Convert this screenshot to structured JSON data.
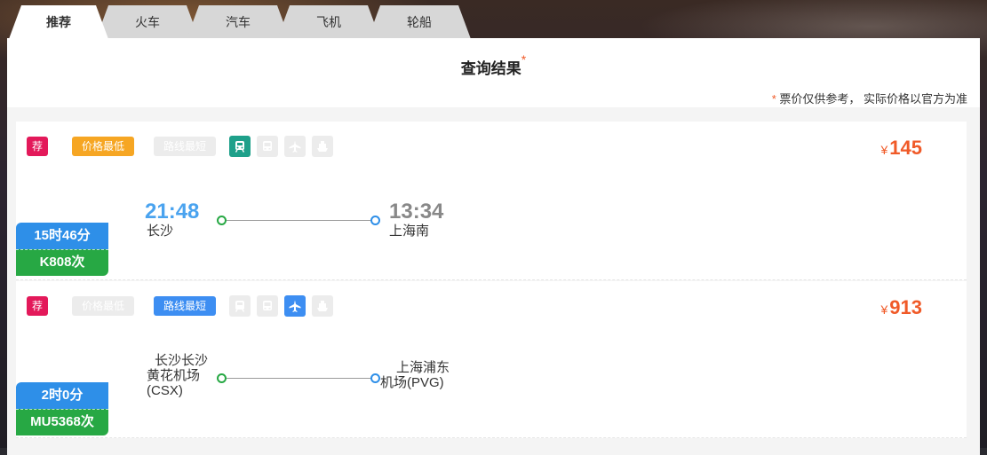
{
  "tabs": [
    {
      "label": "推荐",
      "active": true
    },
    {
      "label": "火车",
      "active": false
    },
    {
      "label": "汽车",
      "active": false
    },
    {
      "label": "飞机",
      "active": false
    },
    {
      "label": "轮船",
      "active": false
    }
  ],
  "header": {
    "title": "查询结果",
    "star": "*",
    "note_star": "*",
    "note": "票价仅供参考， 实际价格以官方为准"
  },
  "results": [
    {
      "recommend_badge": "荐",
      "cheapest_label": "价格最低",
      "cheapest_active": true,
      "shortest_label": "路线最短",
      "shortest_active": false,
      "active_mode": "train-icon",
      "currency": "¥",
      "price": "145",
      "duration": "15时46分",
      "number": "K808次",
      "depart_time": "21:48",
      "depart_station": "长沙",
      "arrive_time": "13:34",
      "arrive_station": "上海南"
    },
    {
      "recommend_badge": "荐",
      "cheapest_label": "价格最低",
      "cheapest_active": false,
      "shortest_label": "路线最短",
      "shortest_active": true,
      "active_mode": "plane-icon",
      "currency": "¥",
      "price": "913",
      "duration": "2时0分",
      "number": "MU5368次",
      "depart_station_line1": "长沙长沙",
      "depart_station_line2": "黄花机场",
      "depart_station_line3": "(CSX)",
      "arrive_station_line1": "上海浦东",
      "arrive_station_line2": "机场(PVG)"
    }
  ],
  "colors": {
    "accent_orange": "#f05a28",
    "recommend_red": "#e3195a",
    "price_low_orange": "#f6a623",
    "route_short_blue": "#3d8ef2",
    "train_teal": "#1ea08a",
    "duration_blue": "#2e8fe8",
    "number_green": "#27a844"
  }
}
